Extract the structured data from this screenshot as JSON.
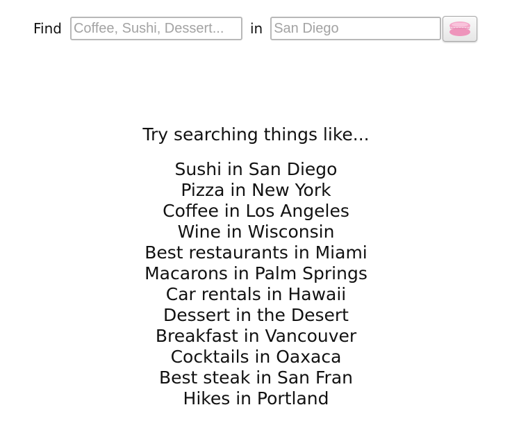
{
  "search": {
    "find_label": "Find",
    "find_placeholder": "Coffee, Sushi, Dessert...",
    "find_value": "",
    "in_label": "in",
    "location_placeholder": "San Diego",
    "location_value": "",
    "button_icon": "macaron-icon"
  },
  "suggestions": {
    "title": "Try searching things like...",
    "items": [
      "Sushi in San Diego",
      "Pizza in New York",
      "Coffee in Los Angeles",
      "Wine in Wisconsin",
      "Best restaurants in Miami",
      "Macarons in Palm Springs",
      "Car rentals in Hawaii",
      "Dessert in the Desert",
      "Breakfast in Vancouver",
      "Cocktails in Oaxaca",
      "Best steak in San Fran",
      "Hikes in Portland"
    ]
  },
  "colors": {
    "macaron_pink": "#f4a6c8",
    "macaron_filling": "#f8dce9",
    "input_border": "#b8b8b8",
    "placeholder": "#a3a3a3"
  }
}
